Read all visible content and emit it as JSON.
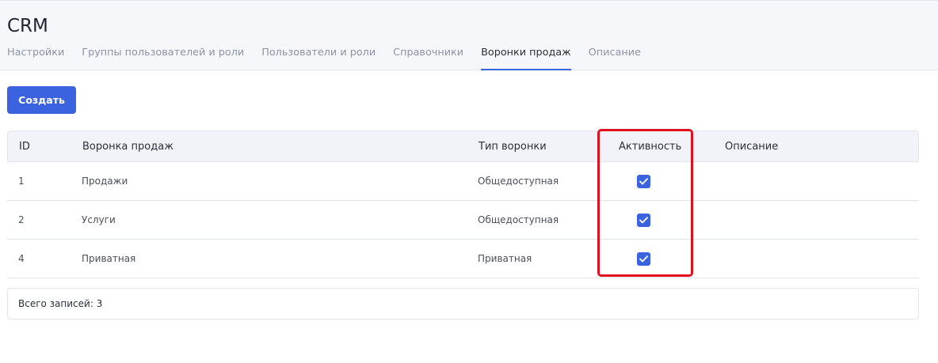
{
  "header": {
    "title": "CRM",
    "tabs": [
      {
        "label": "Настройки",
        "active": false
      },
      {
        "label": "Группы пользователей и роли",
        "active": false
      },
      {
        "label": "Пользователи и роли",
        "active": false
      },
      {
        "label": "Справочники",
        "active": false
      },
      {
        "label": "Воронки продаж",
        "active": true
      },
      {
        "label": "Описание",
        "active": false
      }
    ]
  },
  "toolbar": {
    "create_label": "Создать"
  },
  "table": {
    "columns": [
      "ID",
      "Воронка продаж",
      "Тип воронки",
      "Активность",
      "Описание"
    ],
    "rows": [
      {
        "id": "1",
        "name": "Продажи",
        "type": "Общедоступная",
        "active": true,
        "description": ""
      },
      {
        "id": "2",
        "name": "Услуги",
        "type": "Общедоступная",
        "active": true,
        "description": ""
      },
      {
        "id": "4",
        "name": "Приватная",
        "type": "Приватная",
        "active": true,
        "description": ""
      }
    ]
  },
  "footer": {
    "total_label": "Всего записей: 3"
  },
  "colors": {
    "accent": "#3b63e0",
    "highlight": "#e0111d"
  }
}
